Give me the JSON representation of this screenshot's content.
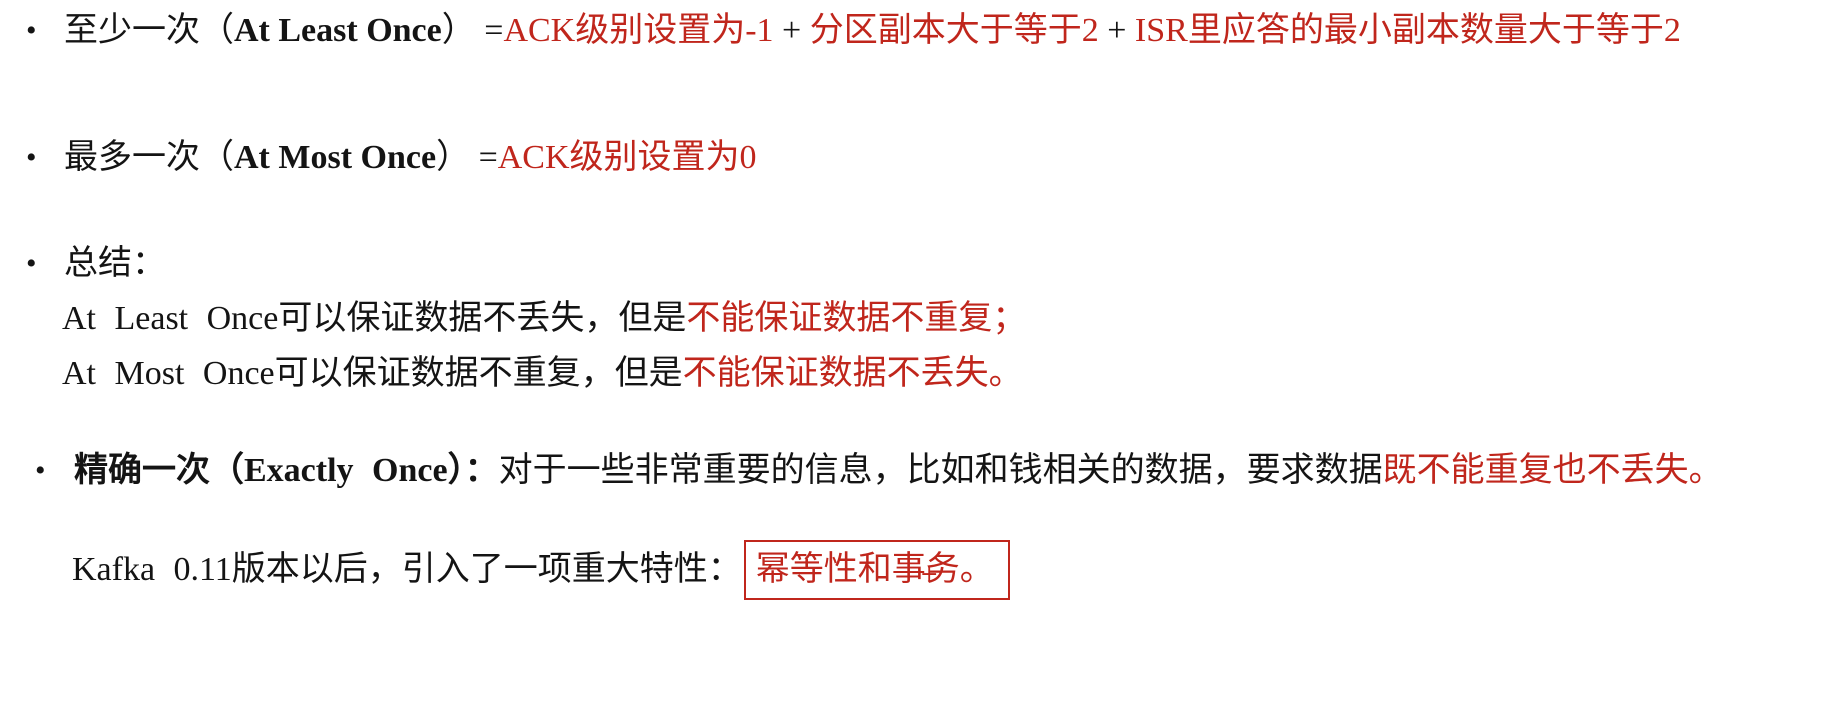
{
  "items": {
    "at_least_once": {
      "bullet": "•",
      "label_cn": "至少一次",
      "paren_open": "（",
      "label_en": "At Least Once",
      "paren_close": "）",
      "equals": "=",
      "cond1": "ACK级别设置为-1",
      "plus1": "+",
      "cond2": "分区副本大于等于2",
      "plus2": "+",
      "cond3": "ISR里应答的最小副本数量大于等于2"
    },
    "at_most_once": {
      "bullet": "•",
      "label_cn": "最多一次",
      "paren_open": "（",
      "label_en": "At Most Once",
      "paren_close": "）",
      "equals": "=",
      "cond1": "ACK级别设置为0"
    },
    "summary": {
      "bullet": "•",
      "title": "总结：",
      "line1_prefix": "At Least Once可以保证数据不丢失，但是",
      "line1_red": "不能保证数据不重复；",
      "line2_prefix": "At Most Once可以保证数据不重复，但是",
      "line2_red": "不能保证数据不丢失。"
    },
    "exactly_once": {
      "bullet": "•",
      "label_cn": "精确一次",
      "paren_open": "（",
      "label_en": "Exactly Once",
      "paren_close": "）：",
      "desc": "对于一些非常重要的信息，比如和钱相关的数据，要求数据",
      "desc_red": "既不能重复也不丢失。",
      "note_prefix": "Kafka 0.11版本以后，引入了一项重大特性：",
      "note_boxed": "幂等性和事务。",
      "note_mark": "+"
    }
  },
  "colors": {
    "text": "#141414",
    "accent_red": "#c0261c",
    "background": "#ffffff"
  }
}
